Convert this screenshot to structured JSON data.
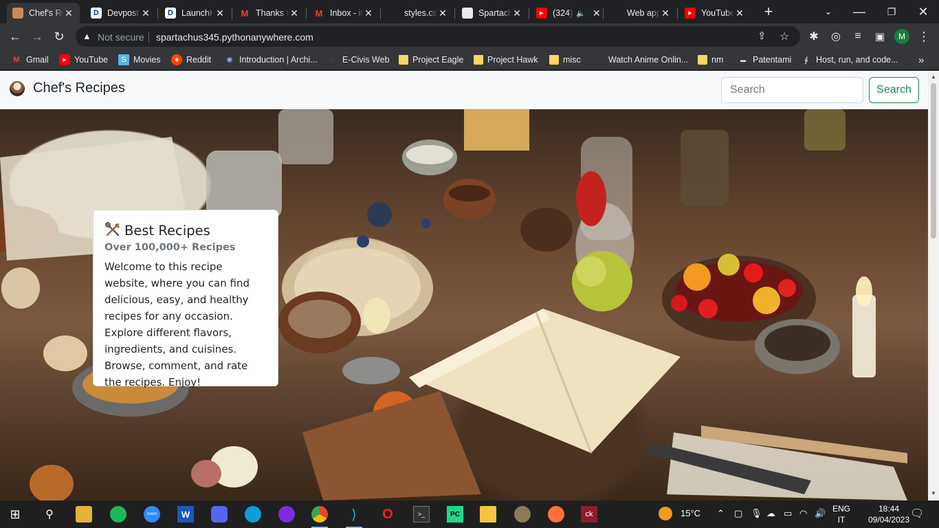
{
  "browser": {
    "tabs": [
      {
        "title": "Chef's Recipes",
        "favicon": "chef-favicon",
        "active": true
      },
      {
        "title": "Devpost",
        "favicon": "devpost-icon"
      },
      {
        "title": "LaunchHacks",
        "favicon": "devpost-icon"
      },
      {
        "title": "Thanks for",
        "favicon": "gmail-icon"
      },
      {
        "title": "Inbox - info",
        "favicon": "gmail-icon"
      },
      {
        "title": "styles.css",
        "favicon": "none"
      },
      {
        "title": "Spartachus",
        "favicon": "github-icon"
      },
      {
        "title": "(324)",
        "favicon": "youtube-icon"
      },
      {
        "title": "Web app",
        "favicon": "none"
      },
      {
        "title": "YouTube",
        "favicon": "youtube-icon"
      }
    ],
    "omnibox": {
      "security_label": "Not secure",
      "url": "spartachus345.pythonanywhere.com"
    },
    "profile_initial": "M",
    "bookmarks": [
      {
        "label": "Gmail",
        "icon": "gmail-icon"
      },
      {
        "label": "YouTube",
        "icon": "youtube-icon"
      },
      {
        "label": "Movies",
        "icon": "movies-icon"
      },
      {
        "label": "Reddit",
        "icon": "reddit-icon"
      },
      {
        "label": "Introduction | Archi...",
        "icon": "archi-icon"
      },
      {
        "label": "E-Civis Web",
        "icon": "ecivis-icon"
      },
      {
        "label": "Project Eagle",
        "icon": "folder-icon"
      },
      {
        "label": "Project Hawk",
        "icon": "folder-icon"
      },
      {
        "label": "misc",
        "icon": "folder-icon"
      },
      {
        "label": "Watch Anime Onlin...",
        "icon": "anime-icon"
      },
      {
        "label": "nm",
        "icon": "folder-icon"
      },
      {
        "label": "Patentami",
        "icon": "patentami-icon"
      },
      {
        "label": "Host, run, and code...",
        "icon": "pythonanywhere-icon"
      }
    ],
    "bookmarks_overflow": "»"
  },
  "site": {
    "brand": "Chef's Recipes",
    "search": {
      "placeholder": "Search",
      "button_label": "Search"
    },
    "hero": {
      "title": "Best Recipes",
      "subtitle": "Over 100,000+ Recipes",
      "body": "Welcome to this recipe website, where you can find delicious, easy, and healthy recipes for any occasion. Explore different flavors, ingredients, and cuisines. Browse, comment, and rate the recipes. Enjoy!"
    }
  },
  "taskbar": {
    "weather": "15°C",
    "language": {
      "line1": "ENG",
      "line2": "IT"
    },
    "time": "18:44",
    "date": "09/04/2023"
  },
  "colors": {
    "chrome_dark": "#202124",
    "chrome_toolbar": "#35363a",
    "search_button": "#198754",
    "navbar_bg": "#f8f9fa"
  }
}
